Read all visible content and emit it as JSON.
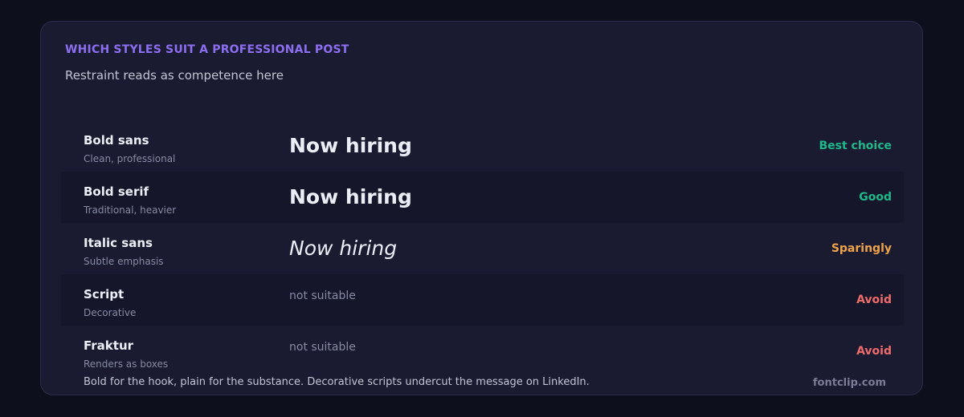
{
  "header": {
    "kicker": "WHICH STYLES SUIT A PROFESSIONAL POST",
    "subtitle": "Restraint reads as competence here"
  },
  "rows": [
    {
      "name": "Bold sans",
      "desc": "Clean, professional",
      "sample": "Now hiring",
      "rating": "Best choice",
      "rating_color": "#1fb88a"
    },
    {
      "name": "Bold serif",
      "desc": "Traditional, heavier",
      "sample": "Now hiring",
      "rating": "Good",
      "rating_color": "#1fb88a"
    },
    {
      "name": "Italic sans",
      "desc": "Subtle emphasis",
      "sample": "Now hiring",
      "rating": "Sparingly",
      "rating_color": "#f0a44a"
    },
    {
      "name": "Script",
      "desc": "Decorative",
      "sample": "not suitable",
      "rating": "Avoid",
      "rating_color": "#ee6b6b"
    },
    {
      "name": "Fraktur",
      "desc": "Renders as boxes",
      "sample": "not suitable",
      "rating": "Avoid",
      "rating_color": "#ee6b6b"
    }
  ],
  "footer": {
    "note": "Bold for the hook, plain for the substance. Decorative scripts undercut the message on LinkedIn.",
    "brand": "fontclip.com"
  }
}
